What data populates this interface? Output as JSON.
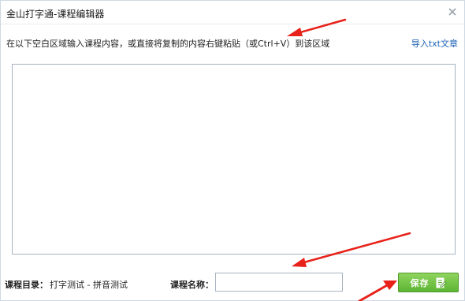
{
  "window": {
    "title": "金山打字通-课程编辑器"
  },
  "instruction": "在以下空白区域输入课程内容，或直接将复制的内容右键粘贴（或Ctrl+V）到该区域",
  "import_link": "导入txt文章",
  "footer": {
    "catalog_label": "课程目录：",
    "catalog_value": "打字测试 - 拼音测试",
    "name_label": "课程名称：",
    "name_value": ""
  },
  "save_button": {
    "label": "保存",
    "color": "#6cc040"
  },
  "annotation_color": "#e8221a"
}
